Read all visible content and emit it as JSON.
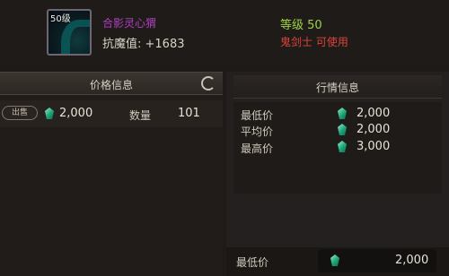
{
  "item": {
    "level_badge": "50级",
    "name": "合影灵心猬",
    "stat": "抗魔值: +1683",
    "required_level": "等级 50",
    "class_restriction": "鬼剑士 可使用"
  },
  "price_panel": {
    "title": "价格信息",
    "sell_label": "出售",
    "price": "2,000",
    "quantity_label": "数量",
    "quantity": "101"
  },
  "market_panel": {
    "title": "行情信息",
    "rows": [
      {
        "label": "最低价",
        "value": "2,000"
      },
      {
        "label": "平均价",
        "value": "2,000"
      },
      {
        "label": "最高价",
        "value": "3,000"
      }
    ],
    "bottom_label": "最低价",
    "bottom_value": "2,000"
  },
  "icons": [
    "refresh-icon",
    "gem-currency-icon"
  ],
  "colors": {
    "item_name": "#b040c0",
    "required_level": "#9fd14a",
    "class_restriction": "#d9443a",
    "gem": "#1ca57a"
  }
}
